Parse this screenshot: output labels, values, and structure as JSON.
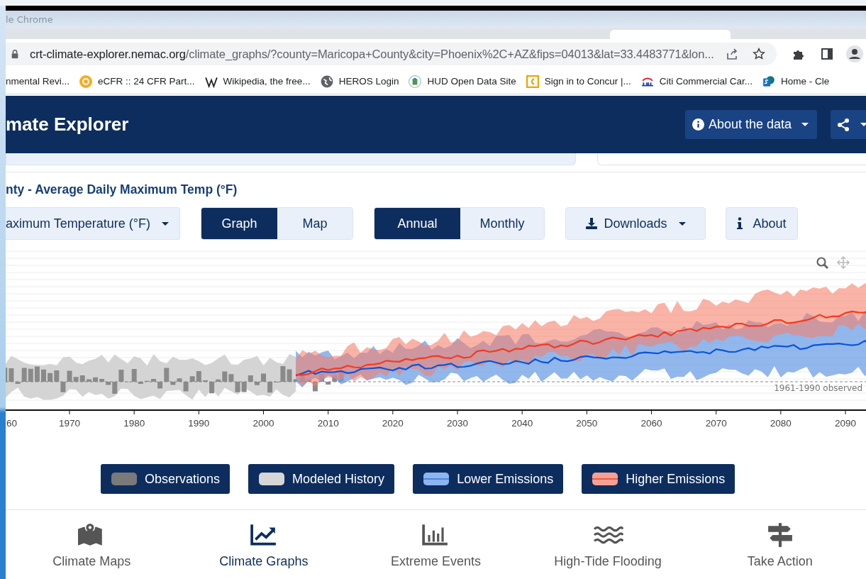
{
  "browser": {
    "title": "le Chrome",
    "url_host": "crt-climate-explorer.nemac.org",
    "url_path": "/climate_graphs/?county=Maricopa+County&city=Phoenix%2C+AZ&fips=04013&lat=33.4483771&lon...",
    "bookmarks": [
      {
        "label": "nmental Revi...",
        "kind": "none"
      },
      {
        "label": "eCFR :: 24 CFR Part...",
        "kind": "ecfr"
      },
      {
        "label": "Wikipedia, the free...",
        "kind": "wiki"
      },
      {
        "label": "HEROS Login",
        "kind": "globe"
      },
      {
        "label": "HUD Open Data Site",
        "kind": "hud"
      },
      {
        "label": "Sign in to Concur |...",
        "kind": "concur"
      },
      {
        "label": "Citi Commercial Car...",
        "kind": "citi"
      },
      {
        "label": "Home - Cle",
        "kind": "sharepoint"
      }
    ]
  },
  "site": {
    "title": "mate Explorer",
    "about_button": "About the data"
  },
  "chart_title": "nty - Average Daily Maximum Temp (°F)",
  "controls": {
    "variable": "aximum Temperature (°F)",
    "view": [
      {
        "label": "Graph",
        "selected": true
      },
      {
        "label": "Map",
        "selected": false
      }
    ],
    "period": [
      {
        "label": "Annual",
        "selected": true
      },
      {
        "label": "Monthly",
        "selected": false
      }
    ],
    "downloads": "Downloads",
    "about": "About"
  },
  "chart": {
    "x_ticks": [
      "60",
      "1970",
      "1980",
      "1990",
      "2000",
      "2010",
      "2020",
      "2030",
      "2040",
      "2050",
      "2060",
      "2070",
      "2080",
      "2090"
    ],
    "baseline_label": "1961-1990 observed"
  },
  "legend": [
    {
      "label": "Observations",
      "kind": "observations"
    },
    {
      "label": "Modeled History",
      "kind": "modeled"
    },
    {
      "label": "Lower Emissions",
      "kind": "lower"
    },
    {
      "label": "Higher Emissions",
      "kind": "higher"
    }
  ],
  "nav": [
    {
      "label": "Climate Maps",
      "kind": "map",
      "selected": false
    },
    {
      "label": "Climate Graphs",
      "kind": "graph",
      "selected": true
    },
    {
      "label": "Extreme Events",
      "kind": "bars",
      "selected": false
    },
    {
      "label": "High-Tide Flooding",
      "kind": "waves",
      "selected": false
    },
    {
      "label": "Take Action",
      "kind": "sign",
      "selected": false
    }
  ]
}
